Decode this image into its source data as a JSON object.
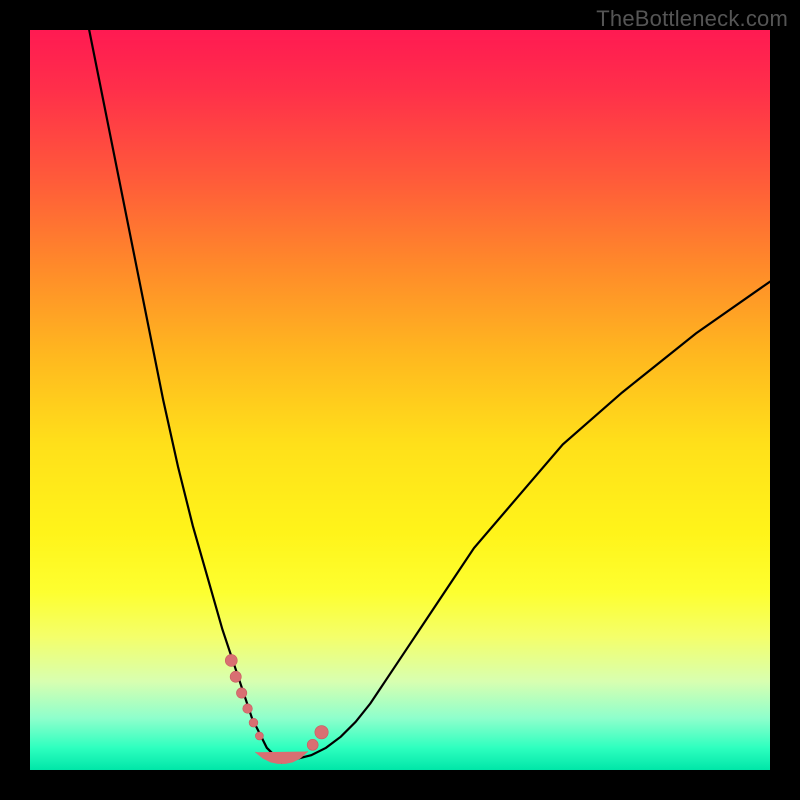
{
  "watermark": "TheBottleneck.com",
  "chart_data": {
    "type": "line",
    "title": "",
    "xlabel": "",
    "ylabel": "",
    "xlim": [
      0,
      100
    ],
    "ylim": [
      0,
      100
    ],
    "grid": false,
    "legend": false,
    "series": [
      {
        "name": "left-branch",
        "x": [
          8,
          10,
          12,
          14,
          16,
          18,
          20,
          22,
          24,
          26,
          27,
          28,
          29,
          30,
          31,
          32,
          33,
          34
        ],
        "values": [
          100,
          90,
          80,
          70,
          60,
          50,
          41,
          33,
          26,
          19,
          16,
          13,
          10,
          7,
          5,
          3,
          2,
          1
        ]
      },
      {
        "name": "right-branch",
        "x": [
          34,
          36,
          38,
          40,
          42,
          44,
          46,
          48,
          52,
          56,
          60,
          66,
          72,
          80,
          90,
          100
        ],
        "values": [
          1,
          1.5,
          2,
          3,
          4.5,
          6.5,
          9,
          12,
          18,
          24,
          30,
          37,
          44,
          51,
          59,
          66
        ]
      },
      {
        "name": "left-markers",
        "x": [
          27.2,
          27.8,
          28.6,
          29.4,
          30.2,
          31.0
        ],
        "values": [
          14.8,
          12.6,
          10.4,
          8.3,
          6.4,
          4.6
        ]
      },
      {
        "name": "right-markers",
        "x": [
          38.2,
          39.4
        ],
        "values": [
          3.4,
          5.1
        ]
      },
      {
        "name": "valley-blob",
        "x": [
          30.5,
          31.5,
          32.5,
          33.5,
          34.5,
          35.5,
          36.5,
          37.5
        ],
        "values": [
          2.4,
          1.6,
          1.1,
          0.9,
          0.9,
          1.1,
          1.6,
          2.5
        ]
      }
    ],
    "background_gradient": {
      "top_color": "#ff1a52",
      "mid_color": "#ffe01a",
      "bottom_color": "#00e6a8"
    }
  }
}
